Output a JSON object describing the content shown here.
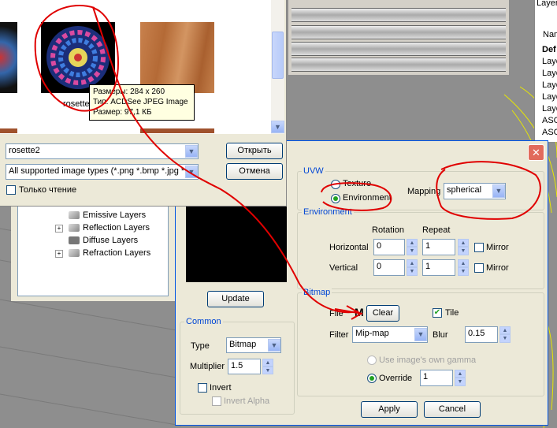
{
  "layers_panel": {
    "title": "Layer",
    "header": "Name",
    "rows": [
      "Def",
      "Laye",
      "Laye",
      "Laye",
      "Laye",
      "Laye",
      "ASG",
      "ASG"
    ]
  },
  "file_dialog": {
    "thumb_label": "rosette",
    "tooltip": {
      "line1": "Размеры: 284 x 260",
      "line2": "Тип: ACDSee JPEG Image",
      "line3": "Размер: 97,1 КБ"
    },
    "filename_value": "rosette2",
    "filetype_value": "All supported image types (*.png *.bmp *.jpg *.jp",
    "open_label": "Открыть",
    "cancel_label": "Отмена",
    "readonly_label": "Только чтение"
  },
  "tree": {
    "items": [
      "Emissive Layers",
      "Reflection Layers",
      "Diffuse Layers",
      "Refraction Layers"
    ]
  },
  "left": {
    "update_label": "Update",
    "common_title": "Common",
    "type_label": "Type",
    "type_value": "Bitmap",
    "multiplier_label": "Multiplier",
    "multiplier_value": "1.5",
    "invert_label": "Invert",
    "invert_alpha_label": "Invert Alpha"
  },
  "uvw": {
    "title": "UVW",
    "texture_label": "Texture",
    "environment_label": "Environment",
    "mapping_label": "Mapping",
    "mapping_value": "spherical"
  },
  "environment": {
    "title": "Environment",
    "rotation_header": "Rotation",
    "repeat_header": "Repeat",
    "horizontal_label": "Horizontal",
    "vertical_label": "Vertical",
    "h_rotation": "0",
    "h_repeat": "1",
    "v_rotation": "0",
    "v_repeat": "1",
    "mirror_label": "Mirror"
  },
  "bitmap": {
    "title": "Bitmap",
    "file_label": "File",
    "file_marker": "M",
    "clear_label": "Clear",
    "tile_label": "Tile",
    "filter_label": "Filter",
    "filter_value": "Mip-map",
    "blur_label": "Blur",
    "blur_value": "0.15",
    "gamma_label": "Use image's own gamma",
    "override_label": "Override",
    "override_value": "1"
  },
  "footer": {
    "apply_label": "Apply",
    "cancel_label": "Cancel"
  },
  "glyphs": {
    "dropdown": "▼",
    "spin_up": "▲",
    "spin_down": "▼",
    "check": "✔",
    "close": "✕",
    "plus": "+"
  }
}
